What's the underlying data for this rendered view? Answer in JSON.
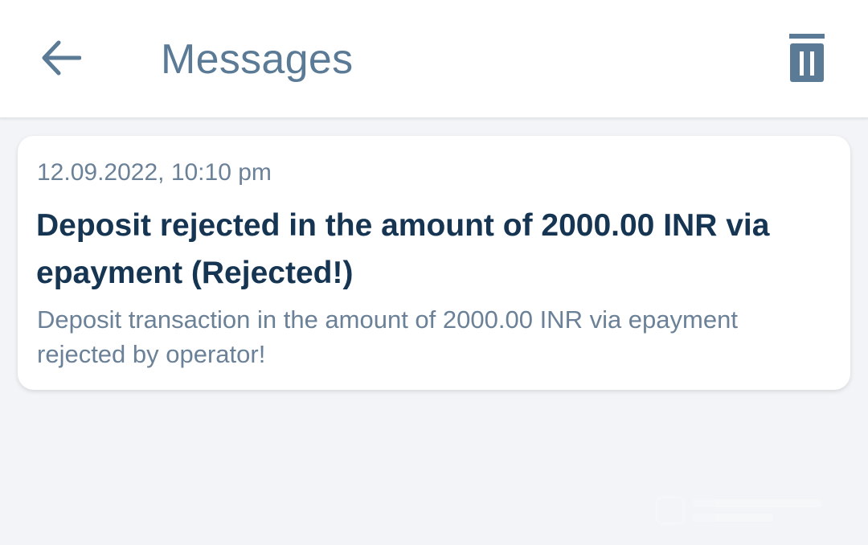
{
  "header": {
    "title": "Messages",
    "back_icon": "arrow-left-icon",
    "delete_icon": "trash-icon"
  },
  "messages": [
    {
      "date": "12.09.2022, 10:10 pm",
      "title": "Deposit rejected in the amount of 2000.00 INR via epayment (Rejected!)",
      "body": "Deposit transaction in the amount of 2000.00 INR via epayment rejected by operator!"
    }
  ],
  "colors": {
    "accent": "#5a7a96",
    "title_text": "#163552",
    "muted_text": "#6b8198",
    "background": "#f2f4f7",
    "card": "#ffffff"
  }
}
